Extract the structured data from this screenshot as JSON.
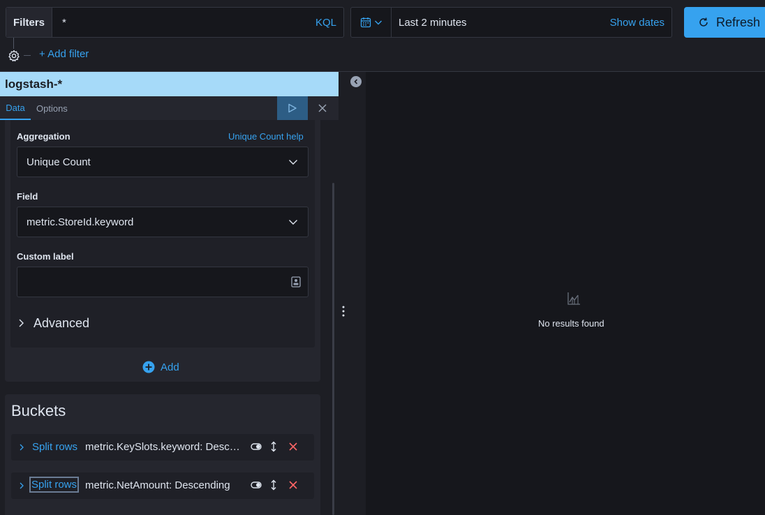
{
  "query_bar": {
    "filters_label": "Filters",
    "query": "*",
    "language": "KQL"
  },
  "date_picker": {
    "range": "Last 2 minutes",
    "show_dates": "Show dates"
  },
  "refresh": {
    "label": "Refresh"
  },
  "filter_bar": {
    "add_filter": "+ Add filter"
  },
  "sidebar": {
    "index_pattern": "logstash-*",
    "tabs": [
      {
        "label": "Data",
        "active": true
      },
      {
        "label": "Options",
        "active": false
      }
    ],
    "metric": {
      "aggregation_label": "Aggregation",
      "aggregation_help": "Unique Count help",
      "aggregation_value": "Unique Count",
      "field_label": "Field",
      "field_value": "metric.StoreId.keyword",
      "custom_label_label": "Custom label",
      "custom_label_value": "",
      "advanced_label": "Advanced"
    },
    "add_label": "Add",
    "buckets": {
      "title": "Buckets",
      "rows": [
        {
          "type": "Split rows",
          "description": "metric.KeySlots.keyword: Descending"
        },
        {
          "type": "Split rows",
          "description": "metric.NetAmount: Descending"
        }
      ]
    }
  },
  "workspace": {
    "empty_message": "No results found"
  },
  "colors": {
    "accent": "#36a2ef",
    "index_bar": "#a6daf9",
    "danger": "#f66",
    "background": "#1d1e24"
  }
}
